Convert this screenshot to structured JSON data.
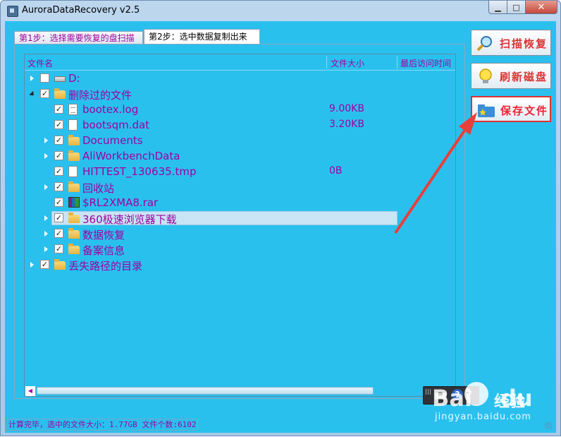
{
  "window": {
    "title": "AuroraDataRecovery v2.5",
    "minimize": "▁",
    "maximize": "□",
    "close": "✕"
  },
  "tabs": [
    {
      "label": "第1步：选择需要恢复的盘扫描",
      "active": false
    },
    {
      "label": "第2步：选中数据复制出来",
      "active": true
    }
  ],
  "columns": {
    "name": "文件名",
    "size": "文件大小",
    "accessed": "最后访问时间"
  },
  "tree": [
    {
      "name": "D:",
      "size": "",
      "icon": "drive-icon",
      "checked": false,
      "expander": "collapsed"
    },
    {
      "name": "删除过的文件",
      "size": "",
      "icon": "folder-icon",
      "checked": true,
      "expander": "expanded"
    },
    {
      "name": "bootex.log",
      "size": "9.00KB",
      "icon": "document-icon",
      "checked": true,
      "expander": "none"
    },
    {
      "name": "bootsqm.dat",
      "size": "3.20KB",
      "icon": "file-icon",
      "checked": true,
      "expander": "none"
    },
    {
      "name": "Documents",
      "size": "",
      "icon": "folder-icon",
      "checked": true,
      "expander": "collapsed"
    },
    {
      "name": "AliWorkbenchData",
      "size": "",
      "icon": "folder-icon",
      "checked": true,
      "expander": "collapsed"
    },
    {
      "name": "HITTEST_130635.tmp",
      "size": "0B",
      "icon": "file-icon",
      "checked": true,
      "expander": "none"
    },
    {
      "name": "回收站",
      "size": "",
      "icon": "folder-icon",
      "checked": true,
      "expander": "collapsed"
    },
    {
      "name": "$RL2XMA8.rar",
      "size": "",
      "icon": "rar-icon",
      "checked": true,
      "expander": "none"
    },
    {
      "name": "360极速浏览器下载",
      "size": "",
      "icon": "folder-icon",
      "checked": true,
      "expander": "collapsed",
      "selected": true
    },
    {
      "name": "数据恢复",
      "size": "",
      "icon": "folder-icon",
      "checked": true,
      "expander": "collapsed"
    },
    {
      "name": "备案信息",
      "size": "",
      "icon": "folder-icon",
      "checked": true,
      "expander": "collapsed"
    },
    {
      "name": "丢失路径的目录",
      "size": "",
      "icon": "folder-icon",
      "checked": true,
      "expander": "collapsed"
    }
  ],
  "buttons": {
    "scan": "扫描恢复",
    "refresh": "刷新磁盘",
    "save": "保存文件"
  },
  "status": "计算完毕，选中的文件大小：1.77GB 文件个数:6102",
  "tray": {
    "help": "?",
    "menu": "▾"
  },
  "watermark": {
    "brand": "Bai",
    "brand2": "du",
    "site_cn": "经验",
    "url": "jingyan.baidu.com"
  },
  "colors": {
    "panel": "#2ac0ee",
    "text": "#a000a0",
    "button_text": "#dd3333",
    "arrow": "#e8403a"
  }
}
